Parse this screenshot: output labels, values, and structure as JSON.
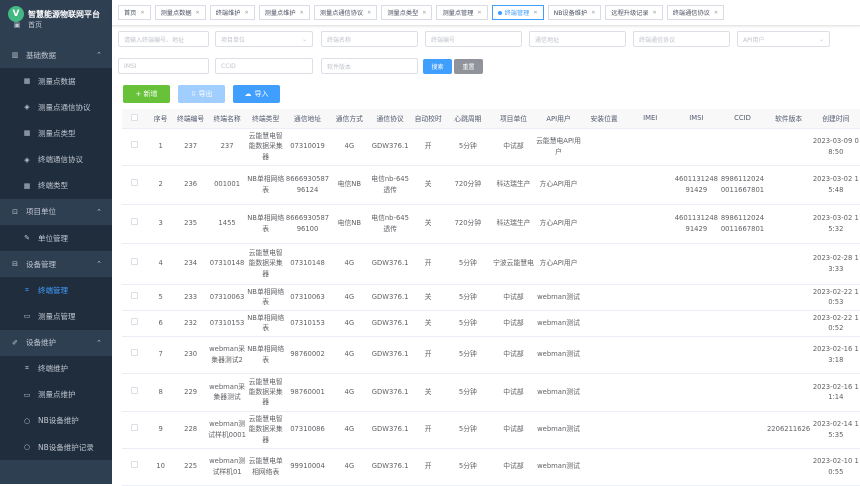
{
  "app": {
    "title": "智慧能源物联网平台",
    "logo_letter": "V"
  },
  "sidebar": {
    "home": "首页",
    "sections": [
      {
        "label": "基础数据",
        "chevron": "⌃",
        "items": [
          {
            "label": "测量点数据",
            "icon": "grid-icon",
            "active": false
          },
          {
            "label": "测量点通信协议",
            "icon": "diamond-icon",
            "active": false
          },
          {
            "label": "测量点类型",
            "icon": "grid-icon",
            "active": false
          },
          {
            "label": "终端通信协议",
            "icon": "diamond-icon",
            "active": false
          },
          {
            "label": "终端类型",
            "icon": "grid-icon",
            "active": false
          }
        ]
      },
      {
        "label": "项目单位",
        "chevron": "⌃",
        "items": [
          {
            "label": "单位管理",
            "icon": "edit-icon",
            "active": false
          }
        ]
      },
      {
        "label": "设备管理",
        "chevron": "⌃",
        "items": [
          {
            "label": "终端管理",
            "icon": "org-icon",
            "active": true
          },
          {
            "label": "测量点管理",
            "icon": "monitor-icon",
            "active": false
          }
        ]
      },
      {
        "label": "设备维护",
        "chevron": "⌃",
        "items": [
          {
            "label": "终端维护",
            "icon": "org-icon",
            "active": false
          },
          {
            "label": "测量点维护",
            "icon": "monitor-icon",
            "active": false
          },
          {
            "label": "NB设备维护",
            "icon": "circle-icon",
            "active": false
          },
          {
            "label": "NB设备维护记录",
            "icon": "circle-icon",
            "active": false
          }
        ]
      }
    ]
  },
  "tags": [
    {
      "label": "首页",
      "active": false
    },
    {
      "label": "测量点数据",
      "active": false
    },
    {
      "label": "终端维护",
      "active": false
    },
    {
      "label": "测量点维护",
      "active": false
    },
    {
      "label": "测量点通信协议",
      "active": false
    },
    {
      "label": "测量点类型",
      "active": false
    },
    {
      "label": "测量点管理",
      "active": false
    },
    {
      "label": "终端管理",
      "active": true
    },
    {
      "label": "NB设备维护",
      "active": false
    },
    {
      "label": "远程升级记录",
      "active": false
    },
    {
      "label": "终端通信协议",
      "active": false
    }
  ],
  "filters": {
    "row1": [
      "请输入终端编号、地址",
      "项目单位",
      "终端名称",
      "终端编号",
      "通信地址",
      "终端通信协议",
      "API用户"
    ],
    "row2": [
      "IMSI",
      "CCID",
      "软件版本"
    ],
    "search_label": "搜索",
    "reset_label": "重置"
  },
  "toolbar": {
    "add_label": "+ 新增",
    "export_label": "⇩ 导出",
    "import_label": "导入",
    "import_icon": "☁"
  },
  "table": {
    "headers": [
      "序号",
      "终端编号",
      "终端名称",
      "终端类型",
      "通信地址",
      "通信方式",
      "通信协议",
      "自动校时",
      "心跳周期",
      "项目单位",
      "API用户",
      "安装位置",
      "IMEI",
      "IMSI",
      "CCID",
      "软件版本",
      "创建时间"
    ],
    "rows": [
      [
        "1",
        "237",
        "237",
        "云能慧电智能数据采集器",
        "07310019",
        "4G",
        "GDW376.1",
        "开",
        "5分钟",
        "中试部",
        "云能慧电API用户",
        "",
        "",
        "",
        "",
        "",
        "2023-03-09 08:50"
      ],
      [
        "2",
        "236",
        "001001",
        "NB单相网络表",
        "866693058796124",
        "电信NB",
        "电信nb-645透传",
        "关",
        "720分钟",
        "科达瑞生产",
        "方心API用户",
        "",
        "",
        "460113124891429",
        "89861120240011667801",
        "",
        "2023-03-02 15:48"
      ],
      [
        "3",
        "235",
        "1455",
        "NB单相网络表",
        "866693058796100",
        "电信NB",
        "电信nb-645透传",
        "关",
        "720分钟",
        "科达瑞生产",
        "方心API用户",
        "",
        "",
        "460113124891429",
        "89861120240011667801",
        "",
        "2023-03-02 15:32"
      ],
      [
        "4",
        "234",
        "07310148",
        "云能慧电智能数据采集器",
        "07310148",
        "4G",
        "GDW376.1",
        "开",
        "5分钟",
        "宁波云能慧电",
        "方心API用户",
        "",
        "",
        "",
        "",
        "",
        "2023-02-28 13:33"
      ],
      [
        "5",
        "233",
        "07310063",
        "NB单相网络表",
        "07310063",
        "4G",
        "GDW376.1",
        "关",
        "5分钟",
        "中试部",
        "webman测试",
        "",
        "",
        "",
        "",
        "",
        "2023-02-22 10:53"
      ],
      [
        "6",
        "232",
        "07310153",
        "NB单相网络表",
        "07310153",
        "4G",
        "GDW376.1",
        "关",
        "5分钟",
        "中试部",
        "webman测试",
        "",
        "",
        "",
        "",
        "",
        "2023-02-22 10:52"
      ],
      [
        "7",
        "230",
        "webman采集器测试2",
        "NB单相网络表",
        "98760002",
        "4G",
        "GDW376.1",
        "开",
        "5分钟",
        "中试部",
        "webman测试",
        "",
        "",
        "",
        "",
        "",
        "2023-02-16 13:18"
      ],
      [
        "8",
        "229",
        "webman采集器测试",
        "云能慧电智能数据采集器",
        "98760001",
        "4G",
        "GDW376.1",
        "关",
        "5分钟",
        "中试部",
        "webman测试",
        "",
        "",
        "",
        "",
        "",
        "2023-02-16 11:14"
      ],
      [
        "9",
        "228",
        "webman测试样机0001",
        "云能慧电智能数据采集器",
        "07310086",
        "4G",
        "GDW376.1",
        "开",
        "5分钟",
        "中试部",
        "webman测试",
        "",
        "",
        "",
        "",
        "2206211626",
        "2023-02-14 15:35"
      ],
      [
        "10",
        "225",
        "webman测试样机01",
        "云能慧电单相网络表",
        "99910004",
        "4G",
        "GDW376.1",
        "开",
        "5分钟",
        "中试部",
        "webman测试",
        "",
        "",
        "",
        "",
        "",
        "2023-02-10 10:55"
      ]
    ]
  },
  "colors": {
    "sidebar_bg": "#2f3f52",
    "submenu_bg": "#1f2d3d",
    "accent": "#409eff",
    "add_btn": "#67c23a",
    "export_btn": "#a0cfff",
    "reset_btn": "#909399"
  }
}
